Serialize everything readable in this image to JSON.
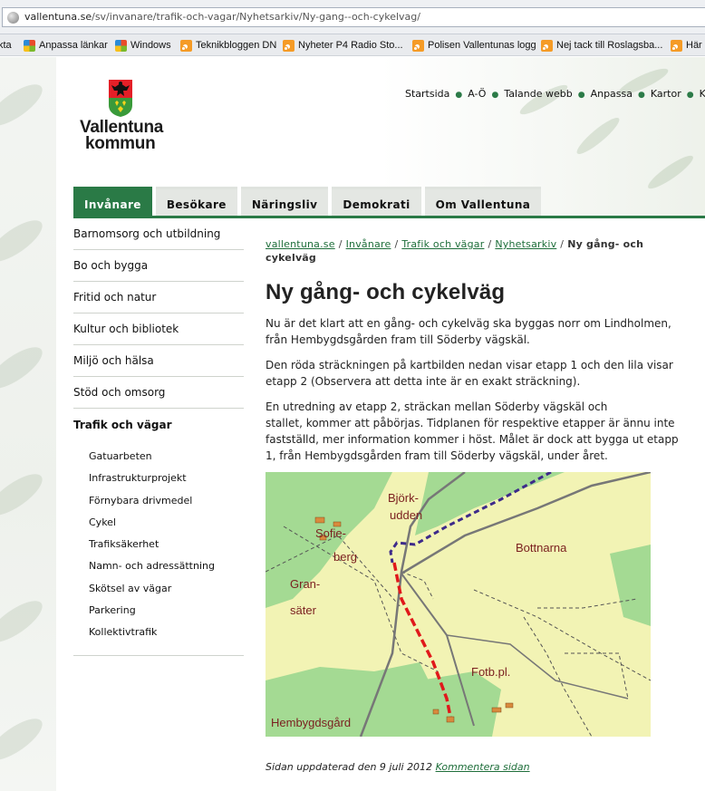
{
  "browser": {
    "url_host": "vallentuna.se",
    "url_path": "/sv/invanare/trafik-och-vagar/Nyhetsarkiv/Ny-gang--och-cykelvag/",
    "bookmarks": [
      {
        "label": "kta",
        "icon": "none"
      },
      {
        "label": "Anpassa länkar",
        "icon": "windows-icon"
      },
      {
        "label": "Windows",
        "icon": "windows-icon"
      },
      {
        "label": "Teknikbloggen DN",
        "icon": "rss-icon"
      },
      {
        "label": "Nyheter P4 Radio Sto...",
        "icon": "rss-icon"
      },
      {
        "label": "Polisen Vallentunas logg",
        "icon": "rss-icon"
      },
      {
        "label": "Nej tack till Roslagsba...",
        "icon": "rss-icon"
      },
      {
        "label": "Här",
        "icon": "rss-icon"
      }
    ]
  },
  "header": {
    "logo_line1": "Vallentuna",
    "logo_line2": "kommun",
    "topnav": [
      "Startsida",
      "A-Ö",
      "Talande webb",
      "Anpassa",
      "Kartor",
      "Ko"
    ]
  },
  "tabs": [
    {
      "label": "Invånare",
      "active": true
    },
    {
      "label": "Besökare",
      "active": false
    },
    {
      "label": "Näringsliv",
      "active": false
    },
    {
      "label": "Demokrati",
      "active": false
    },
    {
      "label": "Om Vallentuna",
      "active": false
    }
  ],
  "sidebar": {
    "items": [
      "Barnomsorg och utbildning",
      "Bo och bygga",
      "Fritid och natur",
      "Kultur och bibliotek",
      "Miljö och hälsa",
      "Stöd och omsorg",
      "Trafik och vägar"
    ],
    "subitems": [
      "Gatuarbeten",
      "Infrastrukturprojekt",
      "Förnybara drivmedel",
      "Cykel",
      "Trafiksäkerhet",
      "Namn- och adressättning",
      "Skötsel av vägar",
      "Parkering",
      "Kollektivtrafik"
    ]
  },
  "breadcrumb": {
    "links": [
      "vallentuna.se",
      "Invånare",
      "Trafik och vägar",
      "Nyhetsarkiv"
    ],
    "current_line1": "Ny gång- och",
    "current_line2": "cykelväg"
  },
  "article": {
    "title": "Ny gång- och cykelväg",
    "p1_line1": "Nu är det klart att en gång- och cykelväg ska byggas norr om Lindholmen,",
    "p1_line2": "från Hembygdsgården fram till Söderby vägskäl.",
    "p2_line1": "Den röda sträckningen på kartbilden nedan visar etapp 1 och den lila visar",
    "p2_line2": "etapp 2 (Observera att detta inte är en exakt sträckning).",
    "p3_line1": "En utredning av etapp 2, sträckan mellan Söderby vägskäl och",
    "p3_line2": "stallet, kommer att påbörjas. Tidplanen för respektive etapper är ännu inte",
    "p3_line3": "fastställd, mer information kommer i höst. Målet är dock att bygga ut etapp",
    "p3_line4": "1, från Hembygdsgården fram till Söderby vägskäl, under året."
  },
  "map": {
    "labels": {
      "bjork1": "Björk-",
      "bjork2": "udden",
      "sofie1": "Sofie-",
      "sofie2": "berg",
      "bottnarna": "Bottnarna",
      "gran1": "Gran-",
      "gran2": "säter",
      "fotb": "Fotb.pl.",
      "hembygd": "Hembygdsgård"
    },
    "colors": {
      "etapp1": "#e0191b",
      "etapp2": "#3d2a8a",
      "field": "#f2f3b4",
      "forest": "#9fd88f"
    }
  },
  "footer": {
    "updated": "Sidan uppdaterad den 9 juli 2012",
    "comment_link": "Kommentera sidan"
  }
}
